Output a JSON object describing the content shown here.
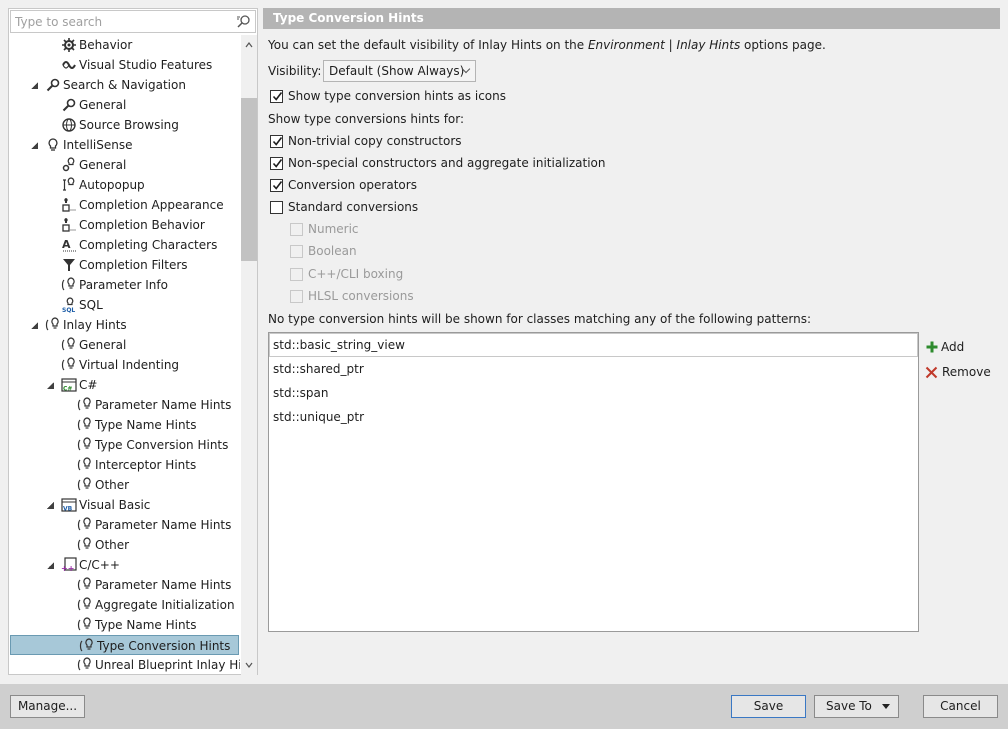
{
  "search": {
    "placeholder": "Type to search"
  },
  "tree": [
    {
      "label": "Behavior",
      "level": 3,
      "icon": "gear"
    },
    {
      "label": "Visual Studio Features",
      "level": 3,
      "icon": "vs"
    },
    {
      "label": "Search & Navigation",
      "level": 2,
      "icon": "search",
      "expanded": true
    },
    {
      "label": "General",
      "level": 3,
      "icon": "search"
    },
    {
      "label": "Source Browsing",
      "level": 3,
      "icon": "globe"
    },
    {
      "label": "IntelliSense",
      "level": 2,
      "icon": "bulb",
      "expanded": true
    },
    {
      "label": "General",
      "level": 3,
      "icon": "bulbgear"
    },
    {
      "label": "Autopopup",
      "level": 3,
      "icon": "bulbcursor"
    },
    {
      "label": "Completion Appearance",
      "level": 3,
      "icon": "list"
    },
    {
      "label": "Completion Behavior",
      "level": 3,
      "icon": "list"
    },
    {
      "label": "Completing Characters",
      "level": 3,
      "icon": "listA"
    },
    {
      "label": "Completion Filters",
      "level": 3,
      "icon": "filter"
    },
    {
      "label": "Parameter Info",
      "level": 3,
      "icon": "hint"
    },
    {
      "label": "SQL",
      "level": 3,
      "icon": "sql"
    },
    {
      "label": "Inlay Hints",
      "level": 2,
      "icon": "hint",
      "expanded": true
    },
    {
      "label": "General",
      "level": 3,
      "icon": "hint"
    },
    {
      "label": "Virtual Indenting",
      "level": 3,
      "icon": "hint"
    },
    {
      "label": "C#",
      "level": 3,
      "icon": "csharp",
      "expanded": true
    },
    {
      "label": "Parameter Name Hints",
      "level": 4,
      "icon": "hint"
    },
    {
      "label": "Type Name Hints",
      "level": 4,
      "icon": "hint"
    },
    {
      "label": "Type Conversion Hints",
      "level": 4,
      "icon": "hint"
    },
    {
      "label": "Interceptor Hints",
      "level": 4,
      "icon": "hint"
    },
    {
      "label": "Other",
      "level": 4,
      "icon": "hint"
    },
    {
      "label": "Visual Basic",
      "level": 3,
      "icon": "vb",
      "expanded": true
    },
    {
      "label": "Parameter Name Hints",
      "level": 4,
      "icon": "hint"
    },
    {
      "label": "Other",
      "level": 4,
      "icon": "hint"
    },
    {
      "label": "C/C++",
      "level": 3,
      "icon": "cpp",
      "expanded": true
    },
    {
      "label": "Parameter Name Hints",
      "level": 4,
      "icon": "hint"
    },
    {
      "label": "Aggregate Initialization",
      "level": 4,
      "icon": "hint"
    },
    {
      "label": "Type Name Hints",
      "level": 4,
      "icon": "hint"
    },
    {
      "label": "Type Conversion Hints",
      "level": 4,
      "icon": "hint",
      "selected": true
    },
    {
      "label": "Unreal Blueprint Inlay Hints",
      "level": 4,
      "icon": "hint"
    }
  ],
  "panel": {
    "title": "Type Conversion Hints",
    "intro_prefix": "You can set the default visibility of Inlay Hints on the ",
    "intro_link": "Environment | Inlay Hints",
    "intro_suffix": " options page.",
    "visibility_label": "Visibility:",
    "visibility_value": "Default (Show Always)",
    "show_as_icons": {
      "label": "Show type conversion hints as icons",
      "checked": true
    },
    "show_for_label": "Show type conversions hints for:",
    "options": [
      {
        "label": "Non-trivial copy constructors",
        "checked": true
      },
      {
        "label": "Non-special constructors and aggregate initialization",
        "checked": true
      },
      {
        "label": "Conversion operators",
        "checked": true
      },
      {
        "label": "Standard conversions",
        "checked": false
      }
    ],
    "sub_options": [
      {
        "label": "Numeric",
        "checked": false
      },
      {
        "label": "Boolean",
        "checked": false
      },
      {
        "label": "C++/CLI boxing",
        "checked": false
      },
      {
        "label": "HLSL conversions",
        "checked": false
      }
    ],
    "patterns_label": "No type conversion hints will be shown for classes matching any of the following patterns:",
    "patterns": [
      "std::basic_string_view",
      "std::shared_ptr",
      "std::span",
      "std::unique_ptr"
    ],
    "add_label": "Add",
    "remove_label": "Remove"
  },
  "footer": {
    "manage": "Manage...",
    "save": "Save",
    "save_to": "Save To",
    "cancel": "Cancel"
  },
  "colors": {
    "accent_green": "#2e8b2e",
    "remove_red": "#c0392b",
    "selected_bg": "#a7c8d8",
    "header_bg": "#b4b4b4"
  }
}
